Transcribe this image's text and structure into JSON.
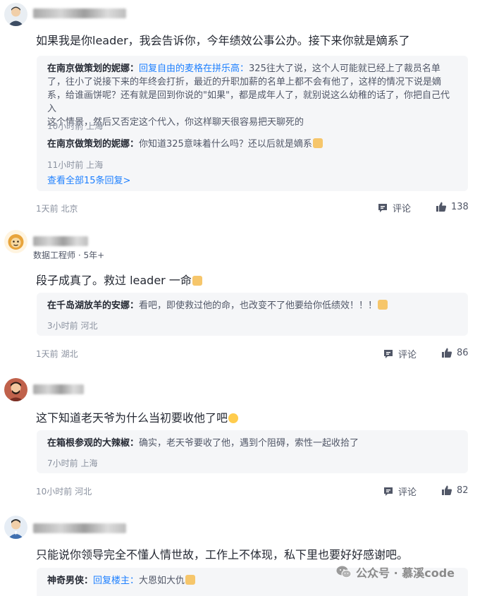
{
  "comments": [
    {
      "text": "如果我是你leader，我会告诉你，今年绩效公事公办。接下来你就是嫡系了",
      "replies": [
        {
          "name": "在南京做策划的妮娜：",
          "reply_to": "回复自由的麦格在拼乐高：",
          "lines": [
            "325往大了说，这个人可能就已经上了裁员名单",
            "了，往小了说接下来的年终会打折，最近的升职加薪的名单上都不会有他了，这样的情况下说是嫡",
            "系，给谁画饼呢？还有就是回到你说的\"如果\"，都是成年人了，就别说这么幼稚的话了，你把自己代入",
            "这个情景，然后又否定这个代入，你这样聊天很容易把天聊死的"
          ],
          "meta": "10小时前 上海"
        },
        {
          "name": "在南京做策划的妮娜：",
          "text": "你知道325意味着什么吗？还以后就是嫡系",
          "meta": "11小时前 上海"
        }
      ],
      "more": "查看全部15条回复>",
      "meta": "1天前 北京",
      "comment_label": "评论",
      "likes": "138"
    },
    {
      "subtitle": "数据工程师 · 5年+",
      "text": "段子成真了。救过 leader 一命",
      "replies": [
        {
          "name": "在千岛湖放羊的安娜：",
          "text": "看吧，即使救过他的命，也改变不了他要给你低绩效！！！",
          "meta": "3小时前 河北"
        }
      ],
      "meta": "1天前 湖北",
      "comment_label": "评论",
      "likes": "86"
    },
    {
      "text": "这下知道老天爷为什么当初要收他了吧",
      "replies": [
        {
          "name": "在箱根参观的大辣椒：",
          "text": "确实，老天爷要收了他，遇到个阻碍，索性一起收拾了",
          "meta": "7小时前 上海"
        }
      ],
      "meta": "10小时前 河北",
      "comment_label": "评论",
      "likes": "82"
    },
    {
      "text": "只能说你领导完全不懂人情世故，工作上不体现，私下里也要好好感谢吧。",
      "replies": [
        {
          "name": "神奇男侠：",
          "reply_to": "回复楼主：",
          "text": "大恩如大仇"
        }
      ]
    }
  ],
  "watermark": "公众号 · 慕溪code",
  "icons": {
    "comment": "comment-icon",
    "like": "thumbs-up-icon",
    "emoji": "emoji-icon",
    "watermark": "wechat-icon"
  },
  "colors": {
    "link": "#1e80ff",
    "reply_bg": "#f5f6f8",
    "meta": "#8a919f"
  }
}
